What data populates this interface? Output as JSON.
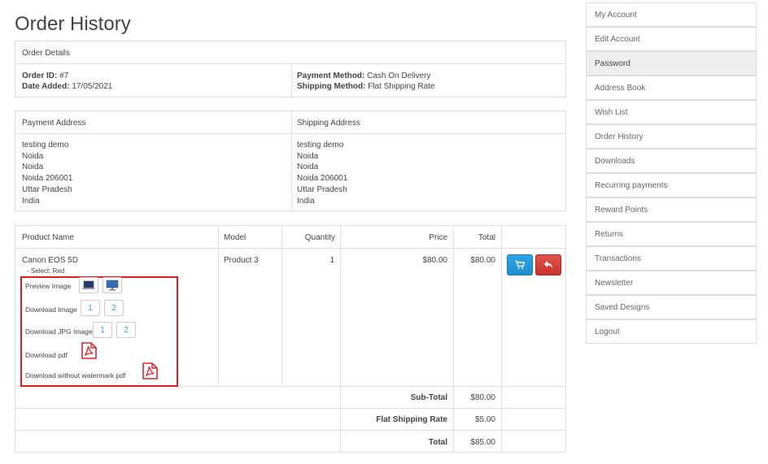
{
  "page": {
    "title": "Order History"
  },
  "order_details": {
    "heading": "Order Details",
    "order_id_label": "Order ID:",
    "order_id": "#7",
    "date_added_label": "Date Added:",
    "date_added": "17/05/2021",
    "payment_method_label": "Payment Method:",
    "payment_method": "Cash On Delivery",
    "shipping_method_label": "Shipping Method:",
    "shipping_method": "Flat Shipping Rate"
  },
  "addresses": {
    "payment_heading": "Payment Address",
    "shipping_heading": "Shipping Address",
    "payment_lines": [
      "testing demo",
      "Noida",
      "Noida",
      "Noida 206001",
      "Uttar Pradesh",
      "India"
    ],
    "shipping_lines": [
      "testing demo",
      "Noida",
      "Noida",
      "Noida 206001",
      "Uttar Pradesh",
      "India"
    ]
  },
  "products": {
    "columns": [
      "Product Name",
      "Model",
      "Quantity",
      "Price",
      "Total"
    ],
    "row": {
      "name": "Canon EOS 5D",
      "option": "- Select: Red",
      "model": "Product 3",
      "quantity": "1",
      "price": "$80.00",
      "total": "$80.00"
    },
    "design_labels": {
      "preview_image": "Preview Image",
      "download_image": "Download Image",
      "download_jpg_image": "Download JPG Image",
      "download_pdf": "Download pdf",
      "download_without_watermark_pdf": "Download without watermark pdf"
    },
    "download_buttons": [
      "1",
      "2"
    ],
    "icons": {
      "reorder": "cart-icon",
      "return": "reply-icon",
      "pdf": "pdf-icon",
      "preview": "monitor-icon"
    },
    "totals": [
      {
        "label": "Sub-Total",
        "value": "$80.00"
      },
      {
        "label": "Flat Shipping Rate",
        "value": "$5.00"
      },
      {
        "label": "Total",
        "value": "$85.00"
      }
    ]
  },
  "sidebar": {
    "items": [
      "My Account",
      "Edit Account",
      "Password",
      "Address Book",
      "Wish List",
      "Order History",
      "Downloads",
      "Recurring payments",
      "Reward Points",
      "Returns",
      "Transactions",
      "Newsletter",
      "Saved Designs",
      "Logout"
    ],
    "active": "Password"
  },
  "colors": {
    "primary": "#2fa4e7",
    "danger": "#c9302c",
    "highlight_frame": "#e31c23",
    "border": "#dddddd"
  }
}
